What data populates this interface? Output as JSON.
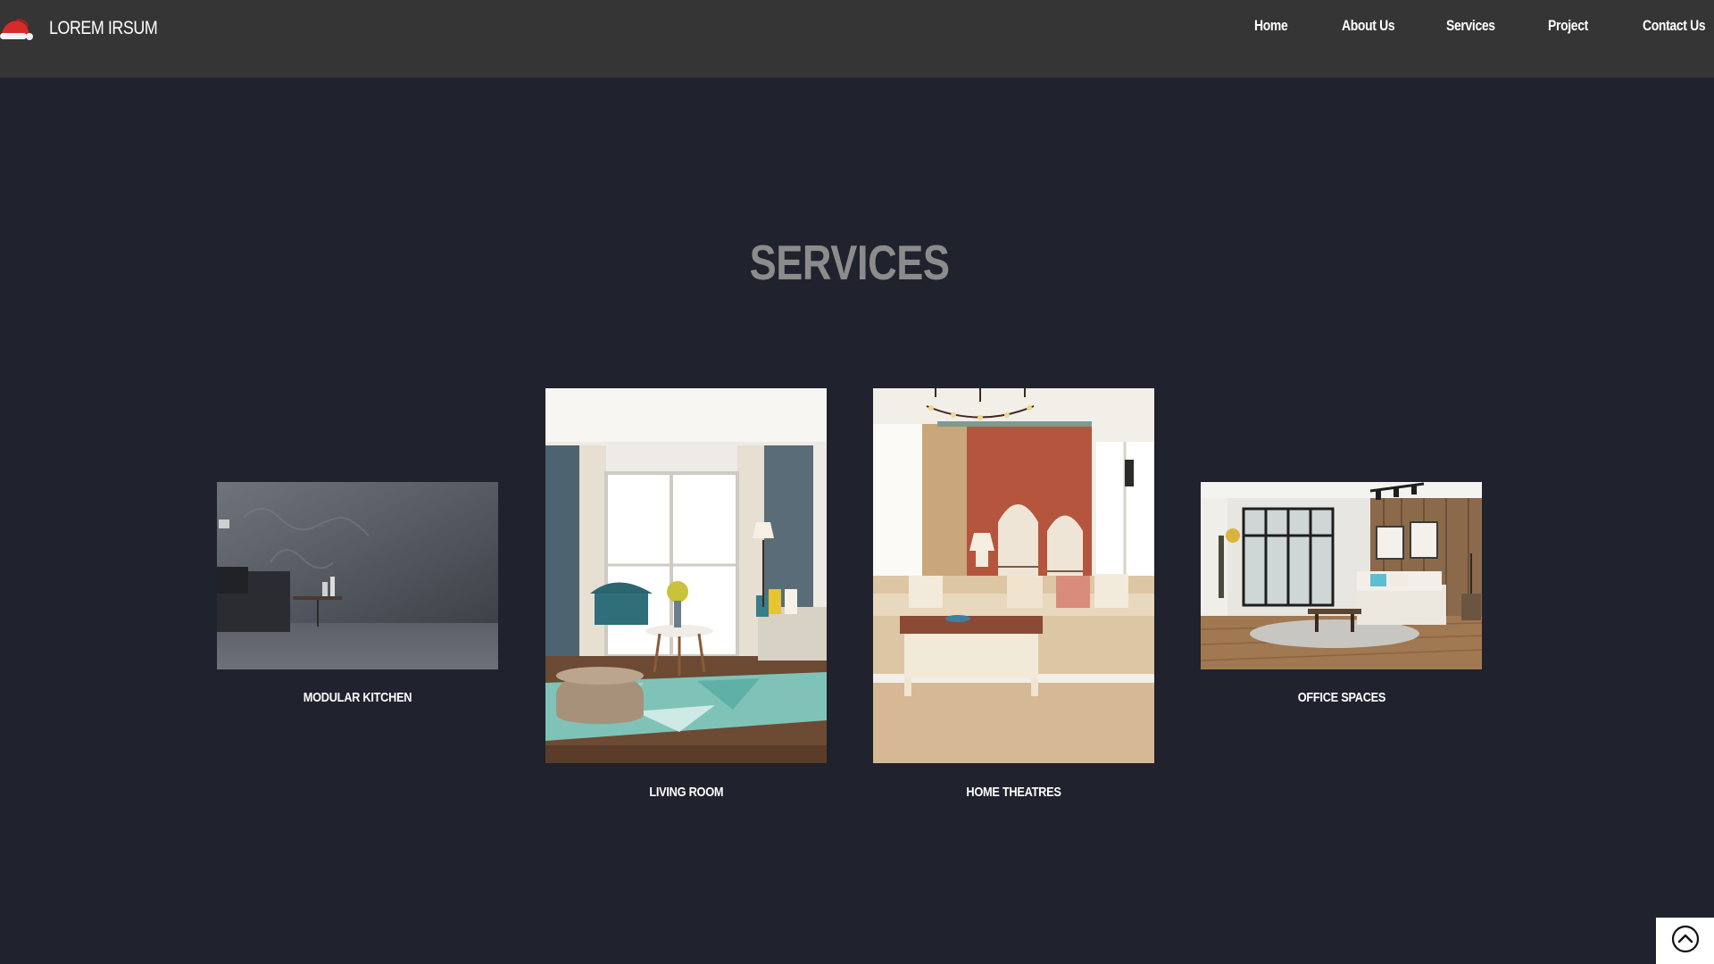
{
  "header": {
    "brand": "LOREM IRSUM",
    "nav": [
      "Home",
      "About Us",
      "Services",
      "Project",
      "Contact Us"
    ]
  },
  "services": {
    "title": "SERVICES",
    "cards": [
      {
        "label": "MODULAR KITCHEN",
        "image": "modular-kitchen-photo"
      },
      {
        "label": "LIVING ROOM",
        "image": "living-room-photo"
      },
      {
        "label": "HOME THEATRES",
        "image": "home-theatre-photo"
      },
      {
        "label": "OFFICE SPACES",
        "image": "office-space-photo"
      }
    ]
  },
  "scroll_top": {
    "icon": "chevron-up-circle-icon"
  },
  "colors": {
    "page_background": "#20222d",
    "navbar_background": "#353535",
    "title": "#8c8c8c",
    "logo_red": "#d62b2b"
  }
}
